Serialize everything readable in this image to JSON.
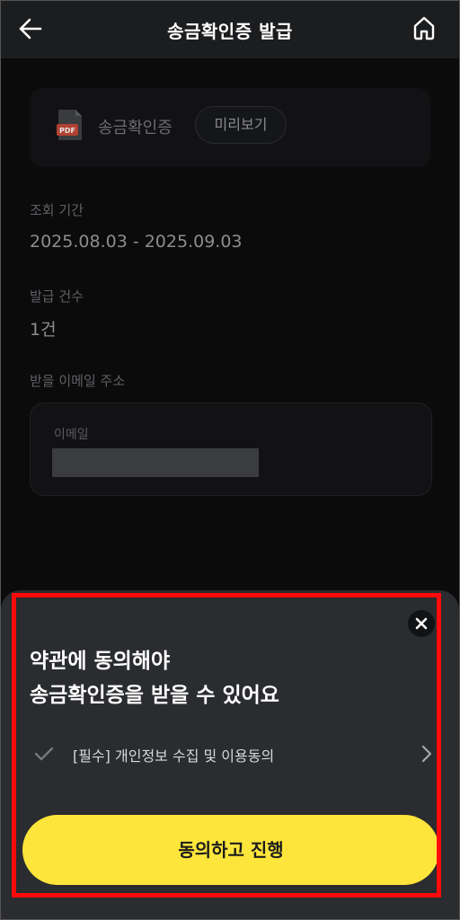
{
  "header": {
    "title": "송금확인증 발급",
    "back_icon": "arrow-left-icon",
    "home_icon": "home-icon"
  },
  "document": {
    "file_icon": "pdf-icon",
    "file_badge": "PDF",
    "label": "송금확인증",
    "preview_label": "미리보기"
  },
  "fields": {
    "period_label": "조회 기간",
    "period_value": "2025.08.03 - 2025.09.03",
    "count_label": "발급 건수",
    "count_value": "1건",
    "email_section_label": "받을 이메일 주소",
    "email_field_label": "이메일",
    "email_value": ""
  },
  "sheet": {
    "title_line1": "약관에 동의해야",
    "title_line2": "송금확인증을 받을 수 있어요",
    "close_icon": "close-icon",
    "agreement_label": "[필수] 개인정보 수집 및 이용동의",
    "check_icon": "check-icon",
    "chevron_icon": "chevron-right-icon",
    "cta_label": "동의하고 진행"
  },
  "colors": {
    "accent": "#fde53b",
    "highlight": "#ff0a0a",
    "background": "#0b0b0c",
    "sheet": "#2a2c2f",
    "pdf_red": "#e0563f"
  }
}
